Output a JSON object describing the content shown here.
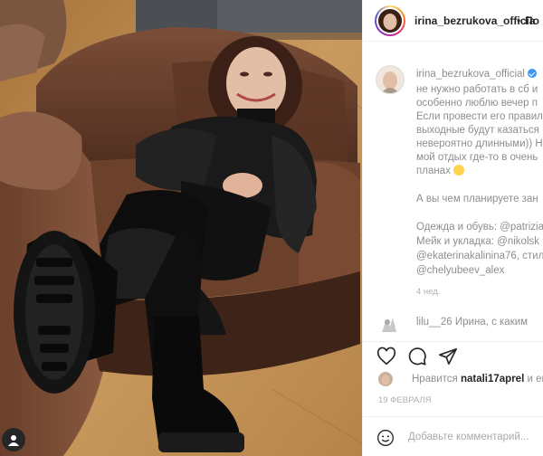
{
  "post": {
    "username": "irina_bezrukova_officia",
    "header_dot": "•",
    "follow_label": "По",
    "verified": true
  },
  "caption": {
    "username": "irina_bezrukova_official",
    "lines": [
      "не нужно работать в сб и",
      "особенно люблю вечер п",
      "Если провести его правил",
      "выходные будут казаться",
      "невероятно длинными)) Н",
      "мой отдых где-то в очень",
      "планах"
    ],
    "question": "А вы чем планируете зан",
    "credits": [
      "Одежда и обувь: @patrizia",
      "Мейк и укладка: @nikolsk",
      "@ekaterinakalinina76, стил",
      "@chelyubeev_alex"
    ],
    "time": "4 нед."
  },
  "comment": {
    "username": "lilu__26",
    "text": "Ирина, с каким"
  },
  "actions": {
    "like_icon": "heart-icon",
    "comment_icon": "comment-bubble-icon",
    "share_icon": "paper-plane-icon"
  },
  "likes": {
    "prefix": "Нравится",
    "user": "natali17aprel",
    "suffix": "и ещё"
  },
  "date": "19 ФЕВРАЛЯ",
  "add_comment": {
    "placeholder": "Добавьте комментарий..."
  },
  "colors": {
    "text": "#262626",
    "muted": "#8e8e8e",
    "verified": "#3897f0",
    "border": "#efefef"
  }
}
